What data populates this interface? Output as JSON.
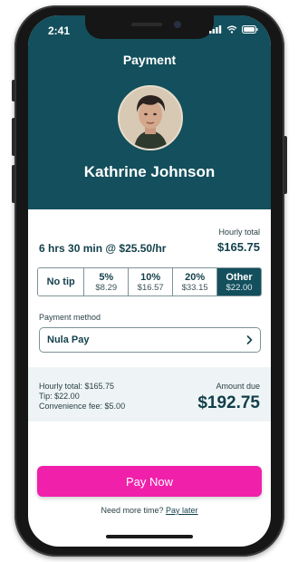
{
  "status_bar": {
    "time": "2:41"
  },
  "header": {
    "title": "Payment",
    "name": "Kathrine Johnson"
  },
  "booking": {
    "hourly_total_label": "Hourly total",
    "duration_rate": "6 hrs 30 min @ $25.50/hr",
    "hourly_total_value": "$165.75"
  },
  "tips": [
    {
      "label": "No tip",
      "amount": ""
    },
    {
      "label": "5%",
      "amount": "$8.29"
    },
    {
      "label": "10%",
      "amount": "$16.57"
    },
    {
      "label": "20%",
      "amount": "$33.15"
    },
    {
      "label": "Other",
      "amount": "$22.00",
      "selected": true
    }
  ],
  "payment_method": {
    "label": "Payment method",
    "value": "Nula Pay"
  },
  "summary": {
    "hourly_total": "Hourly total: $165.75",
    "tip": "Tip: $22.00",
    "convenience_fee": "Convenience fee: $5.00",
    "amount_due_label": "Amount due",
    "amount_due_value": "$192.75"
  },
  "actions": {
    "pay_now": "Pay Now",
    "more_time_prefix": "Need more time?",
    "pay_later": "Pay later"
  },
  "colors": {
    "header_bg": "#134f5c",
    "accent_pink": "#f020ab",
    "summary_bg": "#eef4f5"
  },
  "icons": [
    "cellular-signal-icon",
    "wifi-icon",
    "battery-icon",
    "chevron-right-icon"
  ]
}
